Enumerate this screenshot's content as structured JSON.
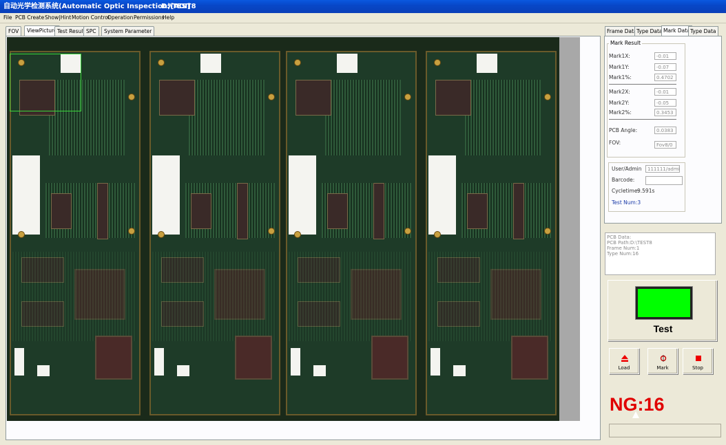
{
  "window": {
    "title": "自动光学检测系统(Automatic Optic Inspection)[AOI]",
    "path": "D:\\TEST8"
  },
  "menu": [
    "File",
    "PCB Create",
    "Show|Hint",
    "Motion Control",
    "Operation",
    "Permissions",
    "Help"
  ],
  "main_tabs": [
    "FOV",
    "ViewPicture",
    "Test Result",
    "SPC",
    "System Parameter"
  ],
  "right_tabs": [
    "Frame Data",
    "Type Data",
    "Mark Data",
    "Type Data"
  ],
  "mark_result": {
    "group_label": "Mark Result",
    "mark1x_label": "Mark1X:",
    "mark1x": "-0.01",
    "mark1y_label": "Mark1Y:",
    "mark1y": "-0.07",
    "mark1pct_label": "Mark1%:",
    "mark1pct": "0.4702",
    "mark2x_label": "Mark2X:",
    "mark2x": "-0.01",
    "mark2y_label": "Mark2Y:",
    "mark2y": "-0.05",
    "mark2pct_label": "Mark2%:",
    "mark2pct": "0.3453",
    "angle_label": "PCB  Angle:",
    "angle": "0.0383",
    "fov_label": "FOV:",
    "fov": "Fov8/0"
  },
  "user_info": {
    "user_label": "User/Admin",
    "user": "111111/admin",
    "barcode_label": "Barcode:",
    "barcode": "",
    "cycletime_label": "Cycletime:",
    "cycletime": "9.591s",
    "testnum": "Test Num:3"
  },
  "pcb_info": [
    "PCB Data:",
    "PCB Path:D:\\TEST8",
    "Frame Num:1",
    "Type Num:16"
  ],
  "test_button": {
    "label": "Test",
    "status_color": "#00ff00"
  },
  "buttons": {
    "load": "Load",
    "mark": "Mark",
    "stop": "Stop"
  },
  "ng_display": "NG:16",
  "colors": {
    "titlebar": "#0747c8",
    "ng": "#e00000"
  }
}
